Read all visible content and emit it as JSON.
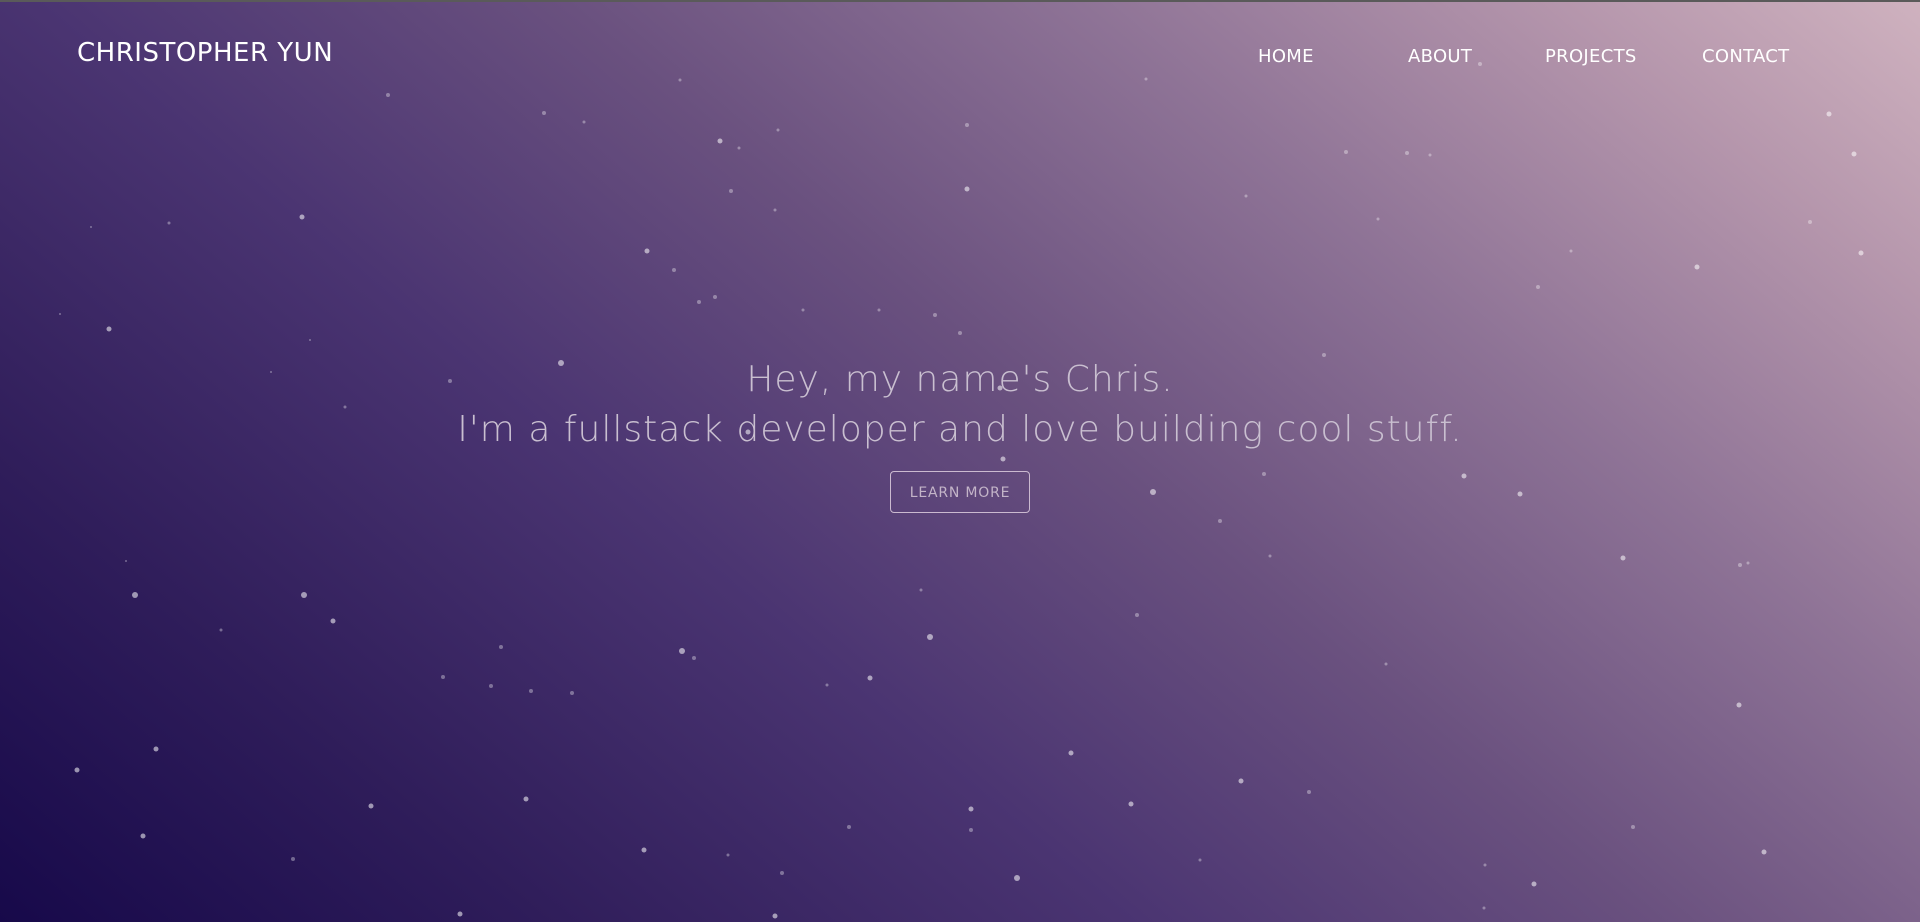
{
  "header": {
    "brand": "CHRISTOPHER YUN",
    "nav": {
      "home": "HOME",
      "about": "ABOUT",
      "projects": "PROJECTS",
      "contact": "CONTACT"
    }
  },
  "hero": {
    "line1": "Hey, my name's Chris.",
    "line2": "I'm a fullstack developer and love building cool stuff.",
    "cta_label": "LEARN MORE"
  },
  "colors": {
    "gradient_bottom_left": "#17094a",
    "gradient_top_right": "#cfb2bf",
    "text_primary": "#ffffff",
    "hero_text": "#c9bfd0"
  }
}
